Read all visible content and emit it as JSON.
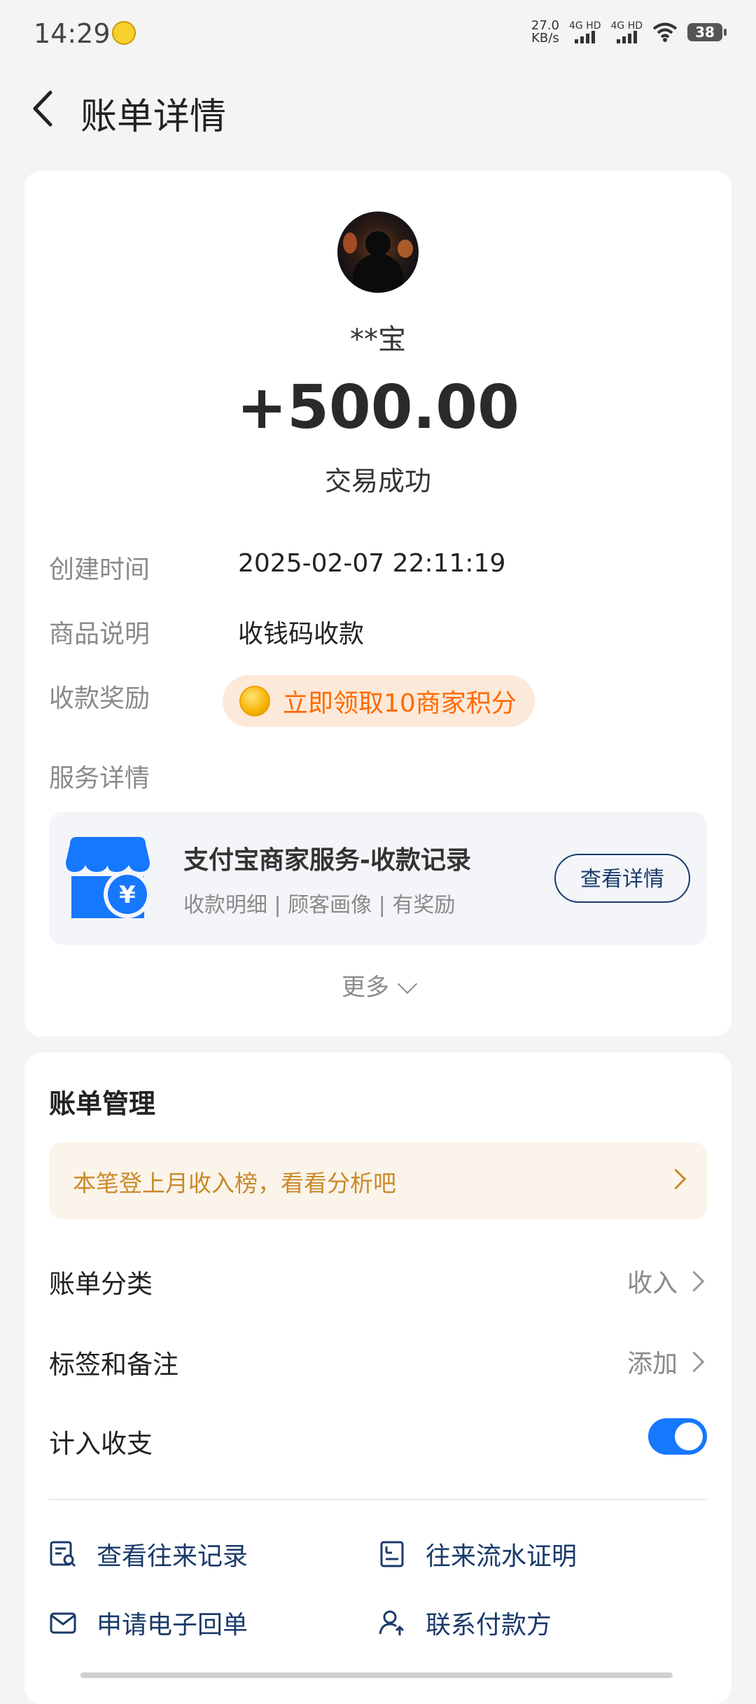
{
  "status_bar": {
    "time": "14:29",
    "net_speed_value": "27.0",
    "net_speed_unit": "KB/s",
    "signal1_label": "4G HD",
    "signal2_label": "4G HD",
    "battery": "38"
  },
  "header": {
    "title": "账单详情"
  },
  "transaction": {
    "payer": "**宝",
    "amount": "+500.00",
    "status": "交易成功",
    "rows": [
      {
        "label": "创建时间",
        "value": "2025-02-07 22:11:19"
      },
      {
        "label": "商品说明",
        "value": "收钱码收款"
      },
      {
        "label": "收款奖励",
        "value": "立即领取10商家积分"
      },
      {
        "label": "服务详情"
      }
    ]
  },
  "service": {
    "title": "支付宝商家服务-收款记录",
    "subtitle": "收款明细 | 顾客画像 | 有奖励",
    "button": "查看详情",
    "brand_color": "#1677ff"
  },
  "more_label": "更多",
  "management": {
    "title": "账单管理",
    "tip": "本笔登上月收入榜，看看分析吧",
    "rows": [
      {
        "label": "账单分类",
        "value": "收入"
      },
      {
        "label": "标签和备注",
        "value": "添加"
      },
      {
        "label": "计入收支",
        "toggle_on": true
      }
    ],
    "actions": [
      {
        "label": "查看往来记录",
        "icon": "record-search-icon"
      },
      {
        "label": "往来流水证明",
        "icon": "statement-proof-icon"
      },
      {
        "label": "申请电子回单",
        "icon": "mail-receipt-icon"
      },
      {
        "label": "联系付款方",
        "icon": "contact-user-icon"
      }
    ]
  }
}
